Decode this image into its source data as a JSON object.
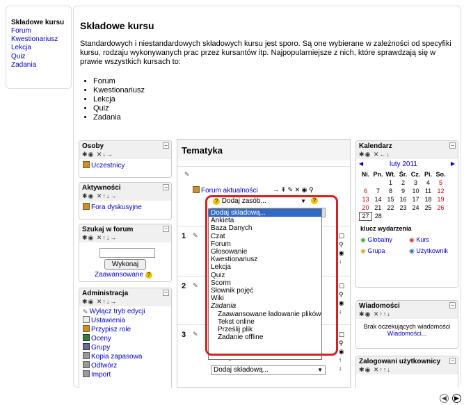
{
  "toc": {
    "title": "Składowe kursu",
    "items": [
      "Forum",
      "Kwestionariusz",
      "Lekcja",
      "Quiz",
      "Zadania"
    ]
  },
  "main": {
    "title": "Składowe kursu",
    "intro": "Standardowych i niestandardowych składowych kursu jest sporo. Są one wybierane w zależności od specyfiki kursu, rodzaju wykonywanych prac przez kursantów itp. Najpopularniejsze z nich, które sprawdzają się w prawie wszystkich kursach to:",
    "bullets": [
      "Forum",
      "Kwestionariusz",
      "Lekcja",
      "Quiz",
      "Zadania"
    ]
  },
  "shot": {
    "osoby": {
      "title": "Osoby",
      "controls": "✱◉ ✕↓→",
      "item": "Uczestnicy"
    },
    "aktywnosci": {
      "title": "Aktywności",
      "controls": "✱◉ ✕↑↓→",
      "item": "Fora dyskusyjne"
    },
    "szukaj": {
      "title": "Szukaj w forum",
      "controls": "✱◉ ✕↑↓→",
      "button": "Wykonaj",
      "advanced": "Zaawansowane"
    },
    "admin": {
      "title": "Administracja",
      "controls": "✱◉ ✕↑↓→",
      "items": [
        "Wyłącz tryb edycji",
        "Ustawienia",
        "Przypisz role",
        "Oceny",
        "Grupy",
        "Kopia zapasowa",
        "Odtwórz",
        "Import"
      ]
    },
    "tematyka": {
      "title": "Tematyka",
      "forum_link": "Forum aktualności",
      "forum_controls": "→ ⇞ ✎ ✕ ◉ ⚲",
      "sections": [
        "1",
        "2",
        "3"
      ],
      "add_resource": "Dodaj zasób...",
      "add_activity": "Dodaj składową...",
      "add_activity_partial": "Dodaj zasób..."
    },
    "dropdown": {
      "options": [
        {
          "label": "Dodaj składową...",
          "kind": "hl"
        },
        {
          "label": "Ankieta",
          "kind": ""
        },
        {
          "label": "Baza Danych",
          "kind": ""
        },
        {
          "label": "Czat",
          "kind": ""
        },
        {
          "label": "Forum",
          "kind": ""
        },
        {
          "label": "Głosowanie",
          "kind": ""
        },
        {
          "label": "Kwestionariusz",
          "kind": ""
        },
        {
          "label": "Lekcja",
          "kind": ""
        },
        {
          "label": "Quiz",
          "kind": ""
        },
        {
          "label": "Scorm",
          "kind": ""
        },
        {
          "label": "Słownik pojęć",
          "kind": ""
        },
        {
          "label": "Wiki",
          "kind": ""
        },
        {
          "label": "Zadania",
          "kind": "grp"
        },
        {
          "label": "Zaawansowane ładowanie plików",
          "kind": "sub"
        },
        {
          "label": "Tekst online",
          "kind": "sub"
        },
        {
          "label": "Prześlij plik",
          "kind": "sub"
        },
        {
          "label": "Zadanie offline",
          "kind": "sub"
        }
      ]
    },
    "kalendarz": {
      "title": "Kalendarz",
      "controls": "✱◉ ✕←↓",
      "month": "luty 2011",
      "days": [
        "Ni.",
        "Pn.",
        "Wt.",
        "Śr.",
        "Cz.",
        "Pi.",
        "So."
      ],
      "weeks": [
        [
          "",
          "",
          "1",
          "2",
          "3",
          "4",
          "5"
        ],
        [
          "6",
          "7",
          "8",
          "9",
          "10",
          "11",
          "12"
        ],
        [
          "13",
          "14",
          "15",
          "16",
          "17",
          "18",
          "19"
        ],
        [
          "20",
          "21",
          "22",
          "23",
          "24",
          "25",
          "26"
        ],
        [
          "27",
          "28",
          "",
          "",
          "",
          "",
          ""
        ]
      ],
      "key_title": "klucz wydarzenia",
      "key": [
        "Globalny",
        "Kurs",
        "Grupa",
        "Użytkownik"
      ]
    },
    "wiadomosci": {
      "title": "Wiadomości",
      "controls": "✱◉ ✕↑↑↓",
      "text": "Brak oczekujących wiadomości",
      "link": "Wiadomości..."
    },
    "zalogowani": {
      "title": "Zalogowani użytkownicy",
      "controls": "✱◉ ✕↑↑↓"
    }
  },
  "colors": {
    "highlight": "#3169c6",
    "callout": "#d42020",
    "link": "#0000cc"
  }
}
